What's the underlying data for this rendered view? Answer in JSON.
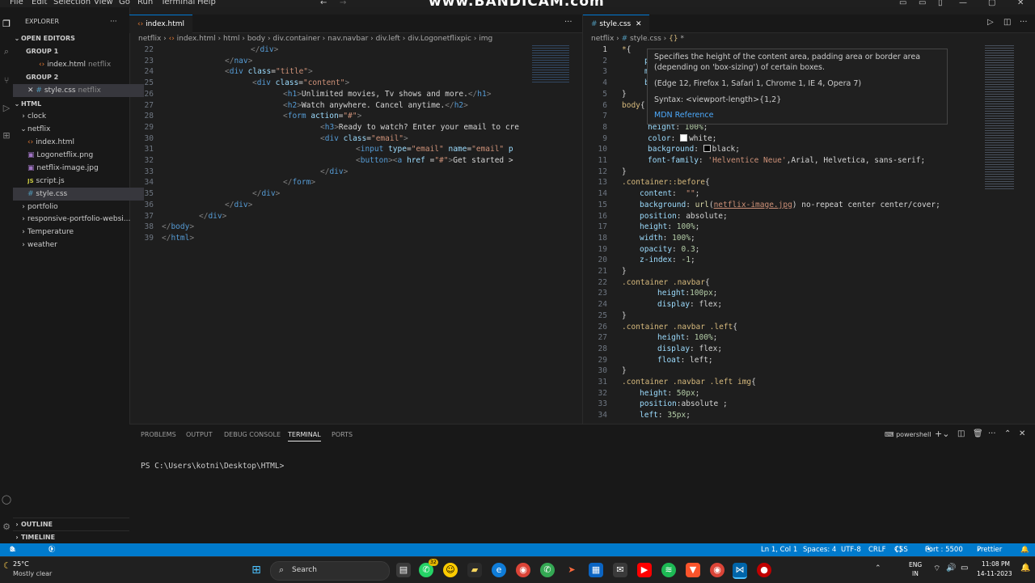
{
  "menu": [
    "File",
    "Edit",
    "Selection",
    "View",
    "Go",
    "Run",
    "Terminal",
    "Help"
  ],
  "watermark": "www.BANDICAM.com",
  "sidebar": {
    "explorer_label": "EXPLORER",
    "open_editors_label": "OPEN EDITORS",
    "group1_label": "GROUP 1",
    "group1_file": "index.html",
    "group1_folder": "netflix",
    "group2_label": "GROUP 2",
    "group2_file": "style.css",
    "group2_folder": "netflix",
    "root_label": "HTML",
    "tree": [
      "clock",
      "netflix",
      "index.html",
      "Logonetflix.png",
      "netflix-image.jpg",
      "script.js",
      "style.css",
      "portfolio",
      "responsive-portfolio-websi...",
      "Temperature",
      "weather"
    ],
    "outline_label": "OUTLINE",
    "timeline_label": "TIMELINE"
  },
  "left_editor": {
    "tab_label": "index.html",
    "breadcrumb": [
      "netflix",
      "index.html",
      "html",
      "body",
      "div.container",
      "nav.navbar",
      "div.left",
      "div.Logonetflixpic",
      "img"
    ],
    "line_numbers": [
      "22",
      "23",
      "24",
      "25",
      "26",
      "27",
      "28",
      "29",
      "30",
      "31",
      "32",
      "33",
      "34",
      "35",
      "36",
      "37",
      "38",
      "39"
    ]
  },
  "right_editor": {
    "tab_label": "style.css",
    "breadcrumb": [
      "netflix",
      "style.css",
      "{}",
      "*"
    ],
    "line_numbers": [
      "1",
      "2",
      "3",
      "4",
      "5",
      "6",
      "7",
      "8",
      "9",
      "10",
      "11",
      "12",
      "13",
      "14",
      "15",
      "16",
      "17",
      "18",
      "19",
      "20",
      "21",
      "22",
      "23",
      "24",
      "25",
      "26",
      "27",
      "28",
      "29",
      "30",
      "31",
      "32",
      "33",
      "34"
    ]
  },
  "hover": {
    "line1": "Specifies the height of the content area, padding area or border area",
    "line2": "(depending on 'box-sizing') of certain boxes.",
    "line3": "(Edge 12, Firefox 1, Safari 1, Chrome 1, IE 4, Opera 7)",
    "line4": "Syntax: <viewport-length>{1,2}",
    "link": "MDN Reference"
  },
  "panel": {
    "tabs": [
      "PROBLEMS",
      "OUTPUT",
      "DEBUG CONSOLE",
      "TERMINAL",
      "PORTS"
    ],
    "active_tab": "TERMINAL",
    "shell": "powershell",
    "prompt": "PS C:\\Users\\kotni\\Desktop\\HTML>"
  },
  "status": {
    "errors": "0",
    "warnings": "0",
    "ports": "0",
    "position": "Ln 1, Col 1",
    "spaces": "Spaces: 4",
    "encoding": "UTF-8",
    "eol": "CRLF",
    "language": "CSS",
    "live": "Port : 5500",
    "prettier": "Prettier"
  },
  "taskbar": {
    "weather_temp": "25°C",
    "weather_text": "Mostly clear",
    "search": "Search",
    "badge": "32",
    "lang1": "ENG",
    "lang2": "IN",
    "time": "11:08 PM",
    "date": "14-11-2023"
  },
  "colors": {
    "accent": "#007acc",
    "tag": "#569cd6",
    "string": "#ce9178",
    "attr": "#9cdcfe"
  }
}
